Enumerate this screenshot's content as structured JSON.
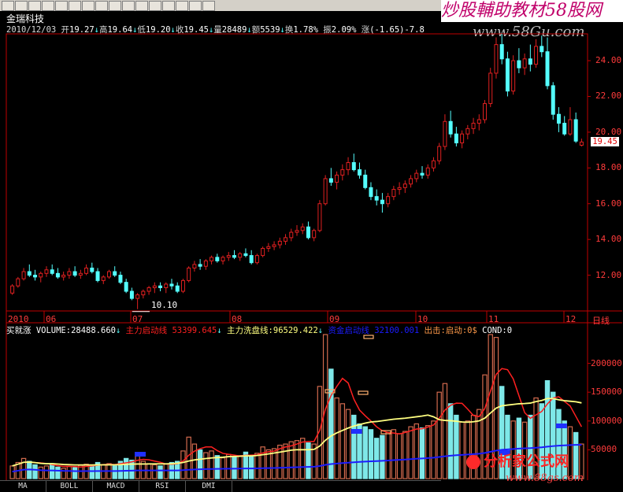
{
  "toolbar": {
    "buttons": [
      "back-icon",
      "forward-icon",
      "cursor-icon",
      "table-icon",
      "edit-icon",
      "chart-icon",
      "grid-icon",
      "calendar-icon",
      "candle-icon",
      "tune-icon",
      "line-icon",
      "zoom-in-icon",
      "zoom-out-icon",
      "config-icon",
      "info-icon",
      "refresh-icon"
    ]
  },
  "watermarks": {
    "top": "炒股輔助教材58股网",
    "url_top": "www.58Gu.com",
    "bottom": "分析家公式网",
    "url_bottom": "www.88gs.com"
  },
  "stock": {
    "name": "金瑞科技"
  },
  "quote": {
    "date": "2010/12/03",
    "open_label": "开",
    "open": "19.27",
    "high_label": "高",
    "high": "19.64",
    "low_label": "低",
    "low": "19.20",
    "close_label": "收",
    "close": "19.45",
    "vol_label": "量",
    "vol": "28489",
    "amt_label": "额",
    "amt": "5539",
    "turn_label": "换",
    "turn": "1.78%",
    "amp_label": "振",
    "amp": "2.09%",
    "chg_label": "涨",
    "chg": "(-1.65)-7.8"
  },
  "price_axis": {
    "labels": [
      "24.00",
      "22.00",
      "20.00",
      "18.00",
      "16.00",
      "14.00",
      "12.00"
    ],
    "current": "19.45"
  },
  "date_axis": {
    "labels": [
      "2010",
      "06",
      "07",
      "08",
      "09",
      "10",
      "11",
      "12"
    ],
    "period": "日线"
  },
  "low_marker": "10.10",
  "indicator": {
    "name": "买就涨",
    "volume_label": "VOLUME:",
    "volume": "28488.660",
    "main_start_label": "主力启动线",
    "main_start": "53399.645",
    "wash_label": "主力洗盘线:",
    "wash": "96529.422",
    "capital_label": "资金启动线",
    "capital": "32100.001",
    "out_label": "出击:",
    "start_label": "启动:",
    "start": "0$",
    "cond_label": "COND:",
    "cond": "0"
  },
  "vol_axis": {
    "labels": [
      "200000",
      "150000",
      "100000",
      "50000"
    ]
  },
  "tabs": [
    "MA",
    "BOLL",
    "MACD",
    "RSI",
    "DMI"
  ],
  "colors": {
    "up": "#e02020",
    "down": "#54ffff",
    "axis": "#c00000",
    "wash": "#ffff80",
    "capital": "#1c1cff",
    "main": "#ff2020"
  },
  "chart_data": {
    "type": "candlestick",
    "title": "金瑞科技",
    "ylim": [
      10,
      25.5
    ],
    "candles": [
      [
        11.0,
        11.5,
        10.9,
        11.4
      ],
      [
        11.4,
        11.9,
        11.3,
        11.8
      ],
      [
        11.8,
        12.4,
        11.7,
        12.2
      ],
      [
        12.2,
        12.6,
        11.9,
        12.0
      ],
      [
        12.0,
        12.3,
        11.7,
        11.9
      ],
      [
        11.9,
        12.2,
        11.6,
        12.1
      ],
      [
        12.1,
        12.5,
        11.9,
        12.3
      ],
      [
        12.3,
        12.6,
        12.0,
        12.1
      ],
      [
        12.1,
        12.4,
        11.8,
        11.9
      ],
      [
        11.9,
        12.2,
        11.7,
        12.0
      ],
      [
        12.0,
        12.4,
        11.8,
        12.2
      ],
      [
        12.2,
        12.5,
        11.9,
        12.0
      ],
      [
        12.0,
        12.3,
        11.8,
        12.1
      ],
      [
        12.1,
        12.6,
        12.0,
        12.4
      ],
      [
        12.4,
        12.7,
        12.1,
        12.2
      ],
      [
        12.2,
        12.4,
        11.6,
        11.7
      ],
      [
        11.7,
        12.0,
        11.5,
        11.9
      ],
      [
        11.9,
        12.3,
        11.8,
        12.2
      ],
      [
        12.2,
        12.5,
        11.9,
        12.0
      ],
      [
        12.0,
        12.2,
        11.5,
        11.6
      ],
      [
        11.6,
        11.8,
        11.0,
        11.1
      ],
      [
        11.1,
        11.3,
        10.6,
        10.7
      ],
      [
        10.7,
        11.0,
        10.1,
        10.9
      ],
      [
        10.9,
        11.2,
        10.7,
        11.1
      ],
      [
        11.1,
        11.4,
        10.9,
        11.3
      ],
      [
        11.3,
        11.6,
        11.0,
        11.4
      ],
      [
        11.4,
        11.6,
        11.1,
        11.3
      ],
      [
        11.3,
        11.6,
        11.0,
        11.5
      ],
      [
        11.5,
        11.8,
        11.2,
        11.4
      ],
      [
        11.4,
        11.6,
        11.0,
        11.1
      ],
      [
        11.1,
        11.8,
        11.0,
        11.7
      ],
      [
        11.7,
        12.5,
        11.6,
        12.4
      ],
      [
        12.4,
        12.8,
        12.2,
        12.6
      ],
      [
        12.6,
        12.9,
        12.3,
        12.5
      ],
      [
        12.5,
        12.9,
        12.3,
        12.8
      ],
      [
        12.8,
        13.1,
        12.6,
        13.0
      ],
      [
        13.0,
        13.2,
        12.7,
        12.8
      ],
      [
        12.8,
        13.1,
        12.6,
        13.0
      ],
      [
        13.0,
        13.3,
        12.8,
        13.1
      ],
      [
        13.1,
        13.4,
        12.9,
        13.0
      ],
      [
        13.0,
        13.3,
        12.8,
        13.2
      ],
      [
        13.2,
        13.5,
        13.0,
        13.1
      ],
      [
        13.1,
        13.4,
        12.6,
        12.7
      ],
      [
        12.7,
        13.2,
        12.6,
        13.1
      ],
      [
        13.1,
        13.6,
        13.0,
        13.5
      ],
      [
        13.5,
        13.8,
        13.3,
        13.6
      ],
      [
        13.6,
        13.9,
        13.4,
        13.7
      ],
      [
        13.7,
        14.1,
        13.5,
        13.9
      ],
      [
        13.9,
        14.3,
        13.7,
        14.1
      ],
      [
        14.1,
        14.6,
        13.9,
        14.4
      ],
      [
        14.4,
        14.8,
        14.2,
        14.5
      ],
      [
        14.5,
        14.9,
        14.3,
        14.7
      ],
      [
        14.7,
        15.0,
        14.0,
        14.1
      ],
      [
        14.1,
        14.6,
        13.9,
        14.5
      ],
      [
        14.5,
        16.2,
        14.4,
        16.0
      ],
      [
        16.0,
        17.6,
        15.9,
        17.4
      ],
      [
        17.4,
        18.0,
        17.0,
        17.2
      ],
      [
        17.2,
        17.8,
        16.8,
        17.6
      ],
      [
        17.6,
        18.2,
        17.3,
        17.9
      ],
      [
        17.9,
        18.6,
        17.6,
        18.3
      ],
      [
        18.3,
        18.8,
        17.8,
        17.9
      ],
      [
        17.9,
        18.3,
        17.4,
        17.6
      ],
      [
        17.6,
        17.9,
        16.8,
        16.9
      ],
      [
        16.9,
        17.2,
        16.2,
        16.4
      ],
      [
        16.4,
        16.8,
        15.9,
        16.2
      ],
      [
        16.2,
        16.6,
        15.5,
        16.0
      ],
      [
        16.0,
        16.6,
        15.8,
        16.4
      ],
      [
        16.4,
        17.0,
        16.2,
        16.8
      ],
      [
        16.8,
        17.2,
        16.5,
        16.9
      ],
      [
        16.9,
        17.3,
        16.6,
        17.1
      ],
      [
        17.1,
        17.6,
        16.9,
        17.4
      ],
      [
        17.4,
        17.9,
        17.2,
        17.7
      ],
      [
        17.7,
        18.1,
        17.4,
        17.6
      ],
      [
        17.6,
        18.2,
        17.4,
        18.0
      ],
      [
        18.0,
        18.6,
        17.8,
        18.4
      ],
      [
        18.4,
        19.4,
        18.2,
        19.2
      ],
      [
        19.2,
        21.0,
        19.0,
        20.6
      ],
      [
        20.6,
        21.2,
        19.7,
        19.9
      ],
      [
        19.9,
        20.3,
        19.2,
        19.4
      ],
      [
        19.4,
        20.1,
        19.1,
        19.9
      ],
      [
        19.9,
        20.4,
        19.6,
        20.2
      ],
      [
        20.2,
        20.8,
        19.9,
        20.5
      ],
      [
        20.5,
        21.0,
        20.1,
        20.7
      ],
      [
        20.7,
        21.8,
        20.5,
        21.6
      ],
      [
        21.6,
        23.6,
        21.4,
        23.3
      ],
      [
        23.3,
        25.3,
        23.0,
        24.9
      ],
      [
        24.9,
        25.5,
        23.8,
        24.1
      ],
      [
        24.1,
        24.5,
        22.0,
        22.3
      ],
      [
        22.3,
        24.3,
        22.1,
        24.0
      ],
      [
        24.0,
        24.7,
        23.3,
        23.6
      ],
      [
        23.6,
        24.4,
        23.2,
        24.1
      ],
      [
        24.1,
        24.9,
        23.4,
        23.8
      ],
      [
        23.8,
        25.2,
        23.6,
        24.8
      ],
      [
        24.8,
        25.4,
        24.2,
        24.5
      ],
      [
        24.5,
        25.3,
        22.4,
        22.6
      ],
      [
        22.6,
        22.8,
        20.7,
        21.0
      ],
      [
        21.0,
        21.4,
        20.0,
        20.5
      ],
      [
        20.5,
        20.9,
        19.8,
        19.9
      ],
      [
        19.9,
        21.4,
        19.8,
        20.7
      ],
      [
        20.7,
        21.1,
        19.4,
        19.5
      ],
      [
        19.27,
        19.64,
        19.2,
        19.45
      ]
    ],
    "volumes": [
      22,
      28,
      35,
      30,
      24,
      20,
      22,
      26,
      20,
      18,
      21,
      19,
      23,
      25,
      22,
      28,
      24,
      26,
      22,
      30,
      35,
      32,
      40,
      30,
      26,
      24,
      22,
      25,
      28,
      30,
      48,
      72,
      60,
      50,
      45,
      48,
      40,
      36,
      42,
      38,
      40,
      46,
      38,
      44,
      55,
      50,
      52,
      58,
      60,
      64,
      66,
      70,
      62,
      60,
      160,
      250,
      190,
      140,
      130,
      120,
      110,
      95,
      90,
      85,
      70,
      75,
      80,
      85,
      78,
      82,
      90,
      95,
      88,
      92,
      100,
      150,
      165,
      130,
      110,
      98,
      100,
      110,
      120,
      180,
      250,
      245,
      160,
      110,
      100,
      105,
      98,
      110,
      140,
      130,
      170,
      150,
      120,
      100,
      90,
      80,
      60
    ]
  }
}
